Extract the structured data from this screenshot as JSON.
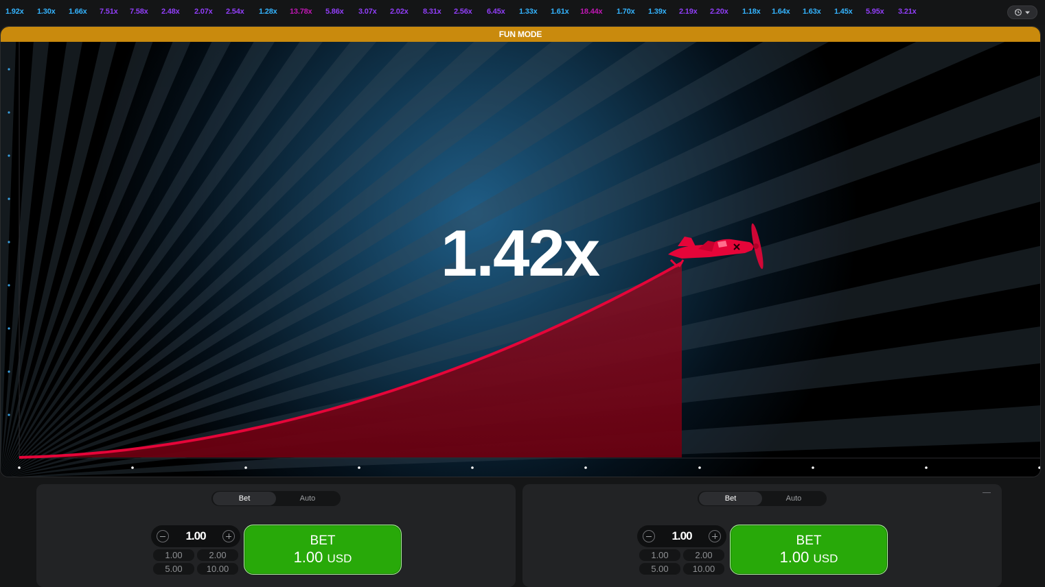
{
  "history": {
    "items": [
      {
        "value": "1.92x",
        "color": "#34b4ff"
      },
      {
        "value": "1.30x",
        "color": "#34b4ff"
      },
      {
        "value": "1.66x",
        "color": "#34b4ff"
      },
      {
        "value": "7.51x",
        "color": "#913ef8"
      },
      {
        "value": "7.58x",
        "color": "#913ef8"
      },
      {
        "value": "2.48x",
        "color": "#913ef8"
      },
      {
        "value": "2.07x",
        "color": "#913ef8"
      },
      {
        "value": "2.54x",
        "color": "#913ef8"
      },
      {
        "value": "1.28x",
        "color": "#34b4ff"
      },
      {
        "value": "13.78x",
        "color": "#c017b4"
      },
      {
        "value": "5.86x",
        "color": "#913ef8"
      },
      {
        "value": "3.07x",
        "color": "#913ef8"
      },
      {
        "value": "2.02x",
        "color": "#913ef8"
      },
      {
        "value": "8.31x",
        "color": "#913ef8"
      },
      {
        "value": "2.56x",
        "color": "#913ef8"
      },
      {
        "value": "6.45x",
        "color": "#913ef8"
      },
      {
        "value": "1.33x",
        "color": "#34b4ff"
      },
      {
        "value": "1.61x",
        "color": "#34b4ff"
      },
      {
        "value": "18.44x",
        "color": "#c017b4"
      },
      {
        "value": "1.70x",
        "color": "#34b4ff"
      },
      {
        "value": "1.39x",
        "color": "#34b4ff"
      },
      {
        "value": "2.19x",
        "color": "#913ef8"
      },
      {
        "value": "2.20x",
        "color": "#913ef8"
      },
      {
        "value": "1.18x",
        "color": "#34b4ff"
      },
      {
        "value": "1.64x",
        "color": "#34b4ff"
      },
      {
        "value": "1.63x",
        "color": "#34b4ff"
      },
      {
        "value": "1.45x",
        "color": "#34b4ff"
      },
      {
        "value": "5.95x",
        "color": "#913ef8"
      },
      {
        "value": "3.21x",
        "color": "#913ef8"
      }
    ]
  },
  "game": {
    "mode_label": "FUN MODE",
    "multiplier": "1.42x",
    "colors": {
      "curve": "#e50539",
      "fill": "#7a0a1c",
      "mode_bar": "#c98a0d",
      "plane": "#e50539"
    }
  },
  "panels": [
    {
      "tab_bet": "Bet",
      "tab_auto": "Auto",
      "stake": "1.00",
      "quick": [
        "1.00",
        "2.00",
        "5.00",
        "10.00"
      ],
      "bet_label": "BET",
      "bet_amount": "1.00",
      "bet_currency": "USD"
    },
    {
      "tab_bet": "Bet",
      "tab_auto": "Auto",
      "stake": "1.00",
      "quick": [
        "1.00",
        "2.00",
        "5.00",
        "10.00"
      ],
      "bet_label": "BET",
      "bet_amount": "1.00",
      "bet_currency": "USD"
    }
  ],
  "icons": {
    "history_button": "history-icon",
    "dropdown": "chevron-down-icon"
  }
}
